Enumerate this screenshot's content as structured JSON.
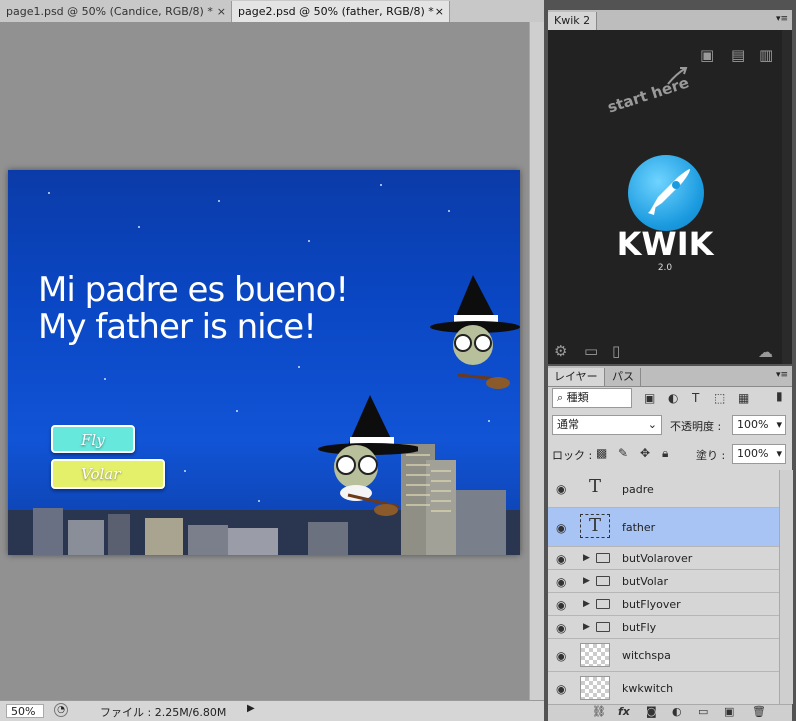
{
  "document_tabs": [
    {
      "label": "page1.psd @ 50% (Candice, RGB/8) *",
      "close": "×"
    },
    {
      "label": "page2.psd @ 50% (father, RGB/8) *",
      "close": "×"
    }
  ],
  "status_bar": {
    "zoom": "50%",
    "file_info": "ファイル : 2.25M/6.80M",
    "arrow": "▶"
  },
  "artboard": {
    "line1": "Mi padre es bueno!",
    "line2": "My father is nice!",
    "button_fly": {
      "label": "Fly",
      "color": "#67e8dd"
    },
    "button_volar": {
      "label": "Volar",
      "color": "#e4f06a"
    },
    "background_color": "#0b46c2"
  },
  "kwik_panel": {
    "tab": "Kwik 2",
    "start_here": "start here",
    "logo_title": "KWIK",
    "logo_version": "2.0",
    "top_icons": [
      "folder-settings-icon",
      "folder-icon",
      "book-icon"
    ],
    "bottom_icons": [
      "gear-icon",
      "print-icon",
      "pages-icon",
      "cloud-icon"
    ]
  },
  "layers_panel": {
    "tabs": [
      "レイヤー",
      "パス"
    ],
    "filter_type": "種類",
    "blend_mode": "通常",
    "opacity_label": "不透明度 :",
    "opacity_value": "100%",
    "lock_label": "ロック :",
    "fill_label": "塗り :",
    "fill_value": "100%",
    "layers": [
      {
        "name": "padre",
        "kind": "text",
        "visible": true,
        "selected": false
      },
      {
        "name": "father",
        "kind": "text",
        "visible": true,
        "selected": true
      },
      {
        "name": "butVolarover",
        "kind": "group",
        "visible": true,
        "selected": false
      },
      {
        "name": "butVolar",
        "kind": "group",
        "visible": true,
        "selected": false
      },
      {
        "name": "butFlyover",
        "kind": "group",
        "visible": true,
        "selected": false
      },
      {
        "name": "butFly",
        "kind": "group",
        "visible": true,
        "selected": false
      },
      {
        "name": "witchspa",
        "kind": "pixel",
        "visible": true,
        "selected": false
      },
      {
        "name": "kwkwitch",
        "kind": "smart",
        "visible": true,
        "selected": false
      }
    ],
    "footer_icons": [
      "link-icon",
      "fx-icon",
      "mask-icon",
      "adjustment-icon",
      "group-icon",
      "new-layer-icon",
      "trash-icon"
    ],
    "footer_fx": "fx"
  }
}
